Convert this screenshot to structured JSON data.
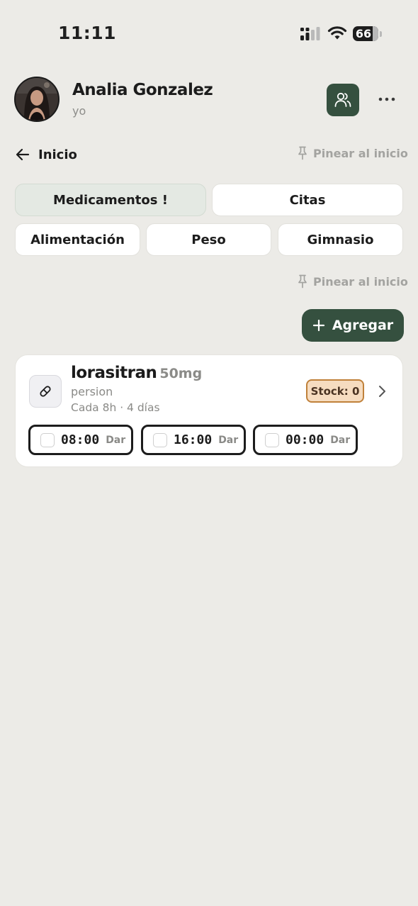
{
  "status_bar": {
    "time": "11:11",
    "battery": "66"
  },
  "header": {
    "name": "Analia Gonzalez",
    "subtitle": "yo",
    "family_icon": "users-icon",
    "more_icon": "more-horizontal-icon"
  },
  "nav": {
    "back_label": "Inicio",
    "pin_label": "Pinear al inicio"
  },
  "tabs": [
    {
      "label": "Medicamentos !",
      "active": true
    },
    {
      "label": "Citas",
      "active": false
    },
    {
      "label": "Alimentación",
      "active": false
    },
    {
      "label": "Peso",
      "active": false
    },
    {
      "label": "Gimnasio",
      "active": false
    }
  ],
  "section": {
    "pin_label": "Pinear al inicio",
    "add_label": "Agregar"
  },
  "medication": {
    "icon": "pill-icon",
    "name": "lorasitran",
    "dose": "50mg",
    "type": "persion",
    "frequency": "Cada 8h · 4 días",
    "stock": "Stock: 0",
    "doses": [
      {
        "time": "08:00",
        "action": "Dar"
      },
      {
        "time": "16:00",
        "action": "Dar"
      },
      {
        "time": "00:00",
        "action": "Dar"
      }
    ]
  },
  "colors": {
    "background": "#ecebe7",
    "primary": "#35503f",
    "stock_bg": "#f6dcc0",
    "stock_border": "#c0813a"
  }
}
